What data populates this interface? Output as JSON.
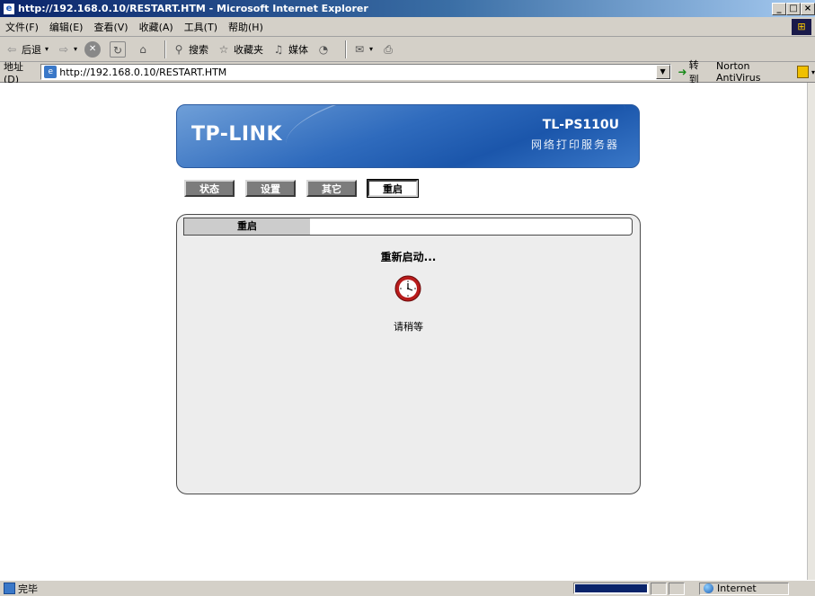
{
  "window": {
    "title": "http://192.168.0.10/RESTART.HTM - Microsoft Internet Explorer",
    "controls": [
      "_",
      "□",
      "×"
    ]
  },
  "menu": {
    "items": [
      "文件(F)",
      "编辑(E)",
      "查看(V)",
      "收藏(A)",
      "工具(T)",
      "帮助(H)"
    ]
  },
  "toolbar": {
    "back": "后退",
    "search": "搜索",
    "favorites": "收藏夹",
    "media": "媒体"
  },
  "address": {
    "label": "地址(D)",
    "url": "http://192.168.0.10/RESTART.HTM",
    "go": "转到",
    "norton": "Norton AntiVirus"
  },
  "banner": {
    "logo": "TP-LINK",
    "model": "TL-PS110U",
    "subtitle": "网络打印服务器"
  },
  "nav": {
    "status": "状态",
    "settings": "设置",
    "other": "其它",
    "restart": "重启"
  },
  "panel": {
    "tab": "重启",
    "message": "重新启动...",
    "wait": "请稍等"
  },
  "statusbar": {
    "text": "完毕",
    "zone": "Internet",
    "progress": 1.0
  }
}
